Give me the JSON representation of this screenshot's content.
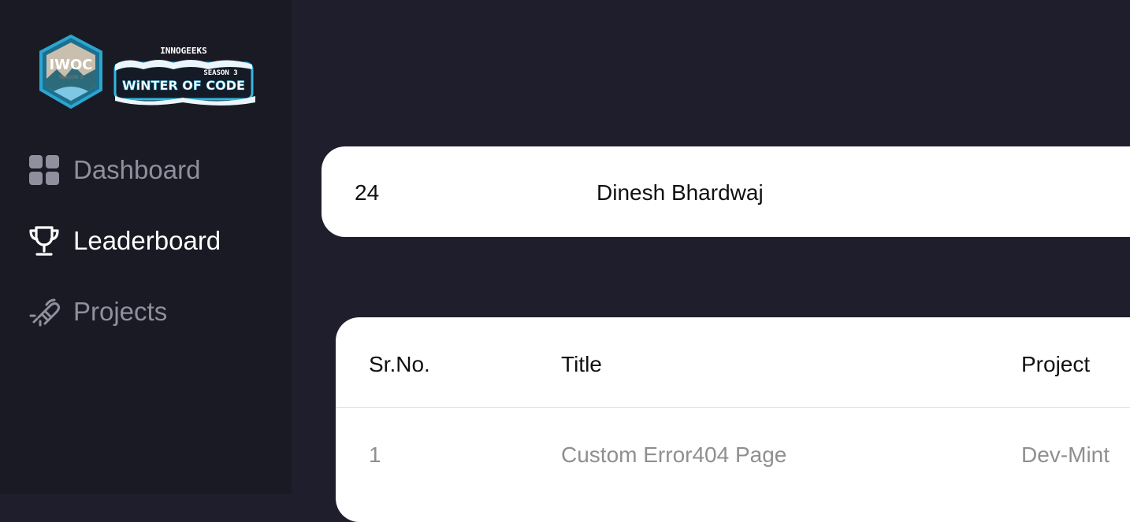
{
  "logo": {
    "badge_text": "IWOC",
    "badge_sub": "SEASON 3",
    "org": "INNOGEEKS",
    "season": "SEASON 3",
    "event": "WiNTER OF CODE"
  },
  "sidebar": {
    "items": [
      {
        "label": "Dashboard",
        "icon": "dashboard-icon",
        "active": false
      },
      {
        "label": "Leaderboard",
        "icon": "trophy-icon",
        "active": true
      },
      {
        "label": "Projects",
        "icon": "projects-icon",
        "active": false
      }
    ]
  },
  "profile": {
    "rank": "24",
    "name": "Dinesh Bhardwaj"
  },
  "table": {
    "headers": [
      "Sr.No.",
      "Title",
      "Project"
    ],
    "rows": [
      {
        "sr": "1",
        "title": "Custom Error404 Page",
        "project": "Dev-Mint"
      }
    ]
  },
  "colors": {
    "background": "#1f1e2d",
    "sidebar": "#1a1a25",
    "active_text": "#ffffff",
    "inactive_text": "#8f8f9e",
    "card": "#ffffff"
  }
}
